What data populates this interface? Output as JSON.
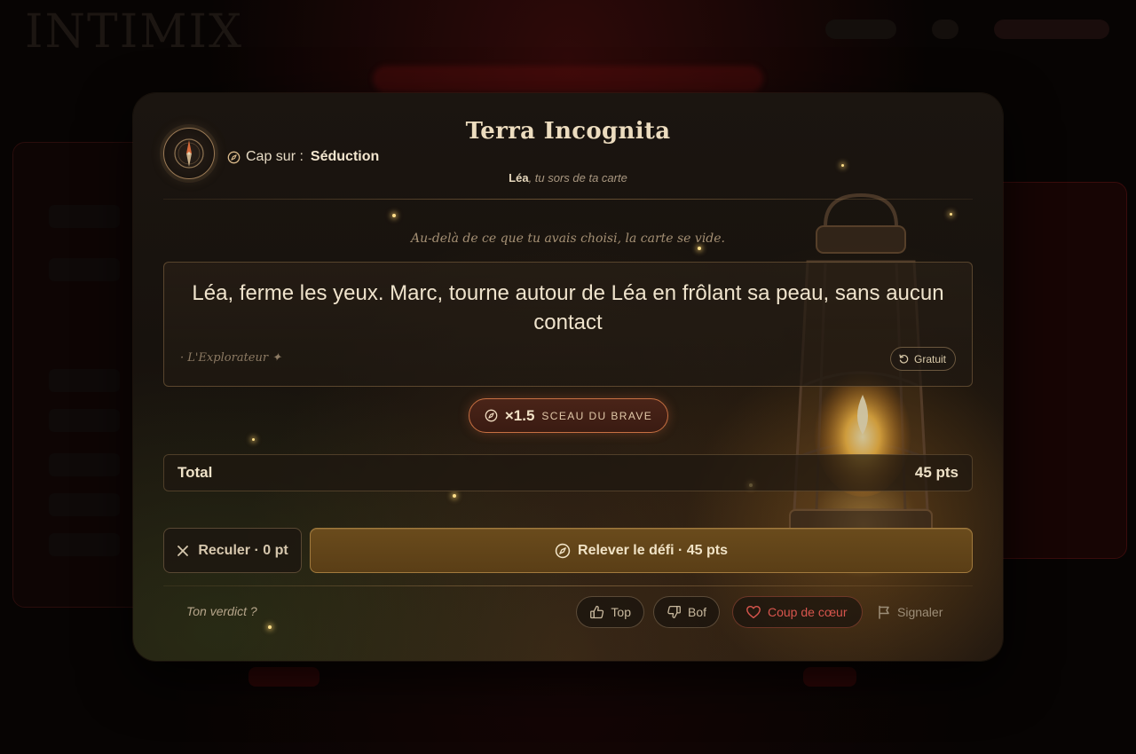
{
  "background": {
    "logo": "INTIMIX"
  },
  "header": {
    "cap_prefix": "Cap sur :",
    "cap_value": "Séduction",
    "title": "Terra Incognita",
    "subtitle_name": "Léa",
    "subtitle_rest": ", tu sors de ta carte"
  },
  "challenge": {
    "lead": "Au-delà de ce que tu avais choisi, la carte se vide.",
    "text": "Léa, ferme les yeux. Marc, tourne autour de Léa en frôlant sa peau, sans aucun contact",
    "signature": "· L'Explorateur ✦",
    "free_label": "Gratuit"
  },
  "seal": {
    "multiplier": "×1.5",
    "label": "SCEAU DU BRAVE"
  },
  "total": {
    "label": "Total",
    "value": "45 pts"
  },
  "actions": {
    "back_label": "Reculer · 0 pt",
    "accept_label": "Relever le défi · 45 pts"
  },
  "verdict": {
    "prompt": "Ton verdict ?",
    "top_label": "Top",
    "bof_label": "Bof",
    "heart_label": "Coup de cœur",
    "report_label": "Signaler"
  },
  "colors": {
    "accent_gold": "#a27a3d",
    "seal_border": "#c77042",
    "heart_red": "#d8554d",
    "text_cream": "#efe3cc"
  },
  "icons": [
    "compass-icon",
    "refresh-icon",
    "close-icon",
    "thumbs-up-icon",
    "thumbs-down-icon",
    "heart-icon",
    "flag-icon"
  ]
}
